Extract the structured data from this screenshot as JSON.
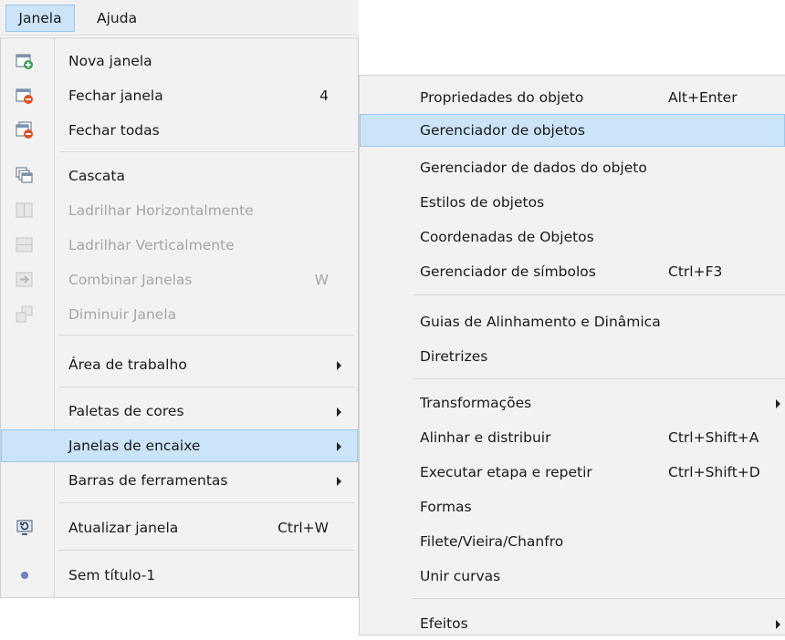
{
  "menubar": {
    "janela": "Janela",
    "ajuda": "Ajuda"
  },
  "janela_menu": {
    "nova_janela": "Nova janela",
    "fechar_janela": "Fechar janela",
    "fechar_janela_num": "4",
    "fechar_todas": "Fechar todas",
    "cascata": "Cascata",
    "ladrilhar_h": "Ladrilhar Horizontalmente",
    "ladrilhar_v": "Ladrilhar Verticalmente",
    "combinar": "Combinar Janelas",
    "combinar_sc": "W",
    "diminuir": "Diminuir Janela",
    "area_trabalho": "Área de trabalho",
    "paletas": "Paletas de cores",
    "janelas_encaixe": "Janelas de encaixe",
    "barras": "Barras de ferramentas",
    "atualizar": "Atualizar janela",
    "atualizar_sc": "Ctrl+W",
    "sem_titulo": "Sem título-1"
  },
  "encaixe_menu": {
    "propriedades": "Propriedades do objeto",
    "propriedades_sc": "Alt+Enter",
    "gerenciador_obj": "Gerenciador de objetos",
    "gerenciador_dados": "Gerenciador de dados do objeto",
    "estilos": "Estilos de objetos",
    "coordenadas": "Coordenadas de Objetos",
    "simbolos": "Gerenciador de símbolos",
    "simbolos_sc": "Ctrl+F3",
    "guias": "Guias de Alinhamento e Dinâmica",
    "diretrizes": "Diretrizes",
    "transformacoes": "Transformações",
    "alinhar": "Alinhar e distribuir",
    "alinhar_sc": "Ctrl+Shift+A",
    "executar": "Executar etapa e repetir",
    "executar_sc": "Ctrl+Shift+D",
    "formas": "Formas",
    "filete": "Filete/Vieira/Chanfro",
    "unir": "Unir curvas",
    "efeitos": "Efeitos"
  }
}
